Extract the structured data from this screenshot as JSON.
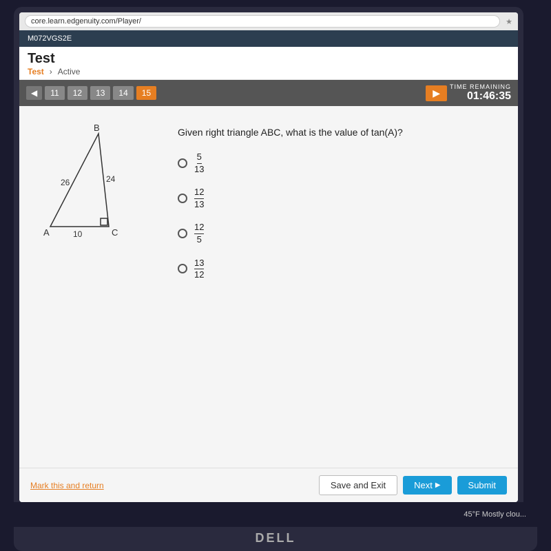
{
  "browser": {
    "url": "core.learn.edgenuity.com/Player/",
    "star_icon": "★"
  },
  "app_header": {
    "course_code": "M072VGS2E"
  },
  "page": {
    "title": "Test",
    "breadcrumb_test": "Test",
    "breadcrumb_status": "Active"
  },
  "navigation": {
    "prev_arrow": "◀",
    "next_arrow": "▶",
    "buttons": [
      "11",
      "12",
      "13",
      "14",
      "15"
    ],
    "active_index": 4,
    "time_label": "TIME REMAINING",
    "time_value": "01:46:35"
  },
  "question": {
    "text": "Given right triangle ABC, what is the value of tan(A)?",
    "triangle": {
      "side_ab": "26",
      "side_bc": "24",
      "side_ac": "10",
      "label_a": "A",
      "label_b": "B",
      "label_c": "C"
    },
    "options": [
      {
        "numerator": "5",
        "denominator": "13"
      },
      {
        "numerator": "12",
        "denominator": "13"
      },
      {
        "numerator": "12",
        "denominator": "5"
      },
      {
        "numerator": "13",
        "denominator": "12"
      }
    ]
  },
  "footer": {
    "mark_link": "Mark this and return",
    "save_exit": "Save and Exit",
    "next": "Next",
    "submit": "Submit"
  },
  "taskbar": {
    "weather": "45°F  Mostly clou..."
  },
  "dell_label": "DELL"
}
